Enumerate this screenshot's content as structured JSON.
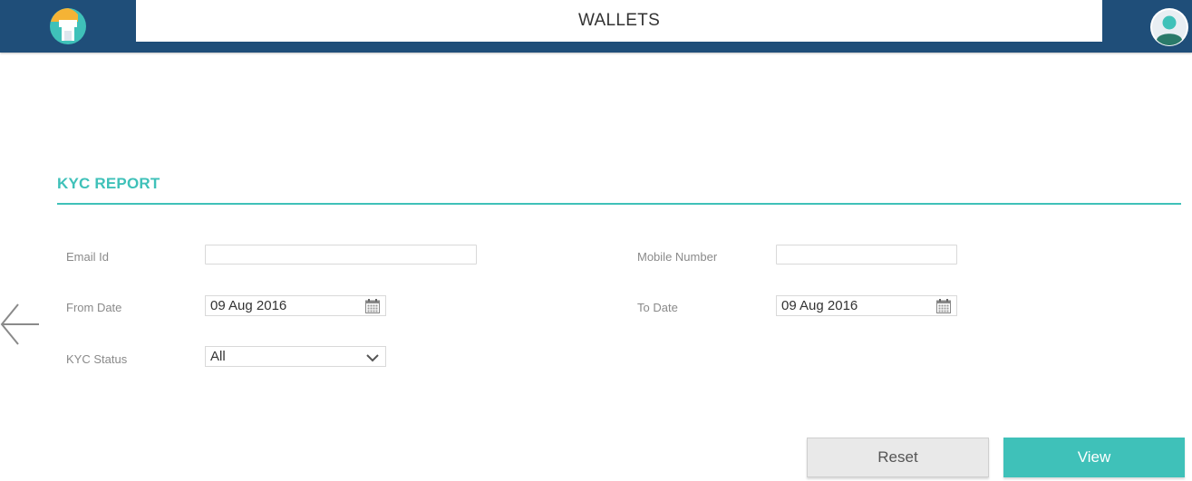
{
  "header": {
    "title": "WALLETS",
    "logo_icon": "shop-logo-icon",
    "avatar_icon": "user-avatar-icon",
    "bar_color": "#1f4e79"
  },
  "nav": {
    "back_icon": "back-arrow-icon"
  },
  "report": {
    "title": "KYC REPORT",
    "accent_color": "#3fc1b9",
    "fields": {
      "email": {
        "label": "Email Id",
        "value": ""
      },
      "mobile": {
        "label": "Mobile Number",
        "value": ""
      },
      "from_date": {
        "label": "From Date",
        "value": "09 Aug 2016",
        "icon": "calendar-icon"
      },
      "to_date": {
        "label": "To Date",
        "value": "09 Aug 2016",
        "icon": "calendar-icon"
      },
      "kyc_status": {
        "label": "KYC Status",
        "value": "All",
        "icon": "chevron-down-icon"
      }
    },
    "buttons": {
      "reset": "Reset",
      "view": "View"
    }
  }
}
